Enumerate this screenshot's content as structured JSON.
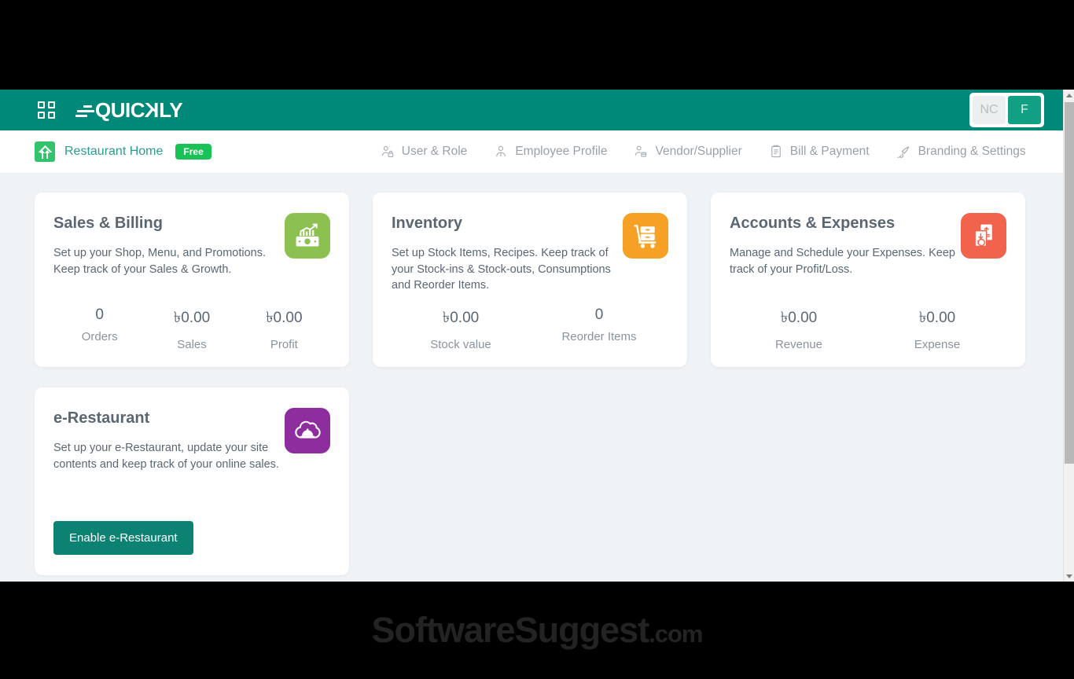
{
  "appbar": {
    "grid_icon": "grid-apps-icon",
    "logo_text": "QUICKLY",
    "toggle": {
      "inactive_label": "NC",
      "active_label": "F"
    },
    "background_color": "#008878"
  },
  "navbar": {
    "home": {
      "icon": "home-growth-icon",
      "label": "Restaurant Home",
      "badge": "Free",
      "badge_color": "#19c257",
      "text_color": "#2a9d8f"
    },
    "items": [
      {
        "label": "User & Role",
        "icon": "user-lock-icon"
      },
      {
        "label": "Employee Profile",
        "icon": "user-icon"
      },
      {
        "label": "Vendor/Supplier",
        "icon": "user-box-icon"
      },
      {
        "label": "Bill & Payment",
        "icon": "invoice-icon"
      },
      {
        "label": "Branding & Settings",
        "icon": "paint-brush-icon"
      }
    ]
  },
  "cards": [
    {
      "id": "sales-billing",
      "title": "Sales & Billing",
      "description": "Set up your Shop, Menu, and Promotions. Keep track of your Sales & Growth.",
      "icon": "money-growth-icon",
      "icon_color": "#8cc152",
      "stats": [
        {
          "value": "0",
          "label": "Orders"
        },
        {
          "value": "৳0.00",
          "label": "Sales"
        },
        {
          "value": "৳0.00",
          "label": "Profit"
        }
      ]
    },
    {
      "id": "inventory",
      "title": "Inventory",
      "description": "Set up Stock Items, Recipes. Keep track of your Stock-ins & Stock-outs, Consumptions and Reorder Items.",
      "icon": "inventory-trolley-icon",
      "icon_color": "#f6a026",
      "stats": [
        {
          "value": "৳0.00",
          "label": "Stock value"
        },
        {
          "value": "0",
          "label": "Reorder Items"
        }
      ]
    },
    {
      "id": "accounts-expenses",
      "title": "Accounts & Expenses",
      "description": "Manage and Schedule your Expenses. Keep track of your Profit/Loss.",
      "icon": "accounts-documents-icon",
      "icon_color": "#f2634e",
      "stats": [
        {
          "value": "৳0.00",
          "label": "Revenue"
        },
        {
          "value": "৳0.00",
          "label": "Expense"
        }
      ]
    },
    {
      "id": "e-restaurant",
      "title": "e-Restaurant",
      "description": "Set up your e-Restaurant, update your site contents and keep track of your online sales.",
      "icon": "cloud-cloche-icon",
      "icon_color": "#8e2d9e",
      "button_label": "Enable e-Restaurant",
      "button_color": "#0b8272"
    }
  ],
  "watermark": {
    "name": "SoftwareSuggest",
    "domain": ".com"
  },
  "scrollbar": {
    "up_icon": "scroll-up-arrow-icon",
    "down_icon": "scroll-down-arrow-icon"
  }
}
